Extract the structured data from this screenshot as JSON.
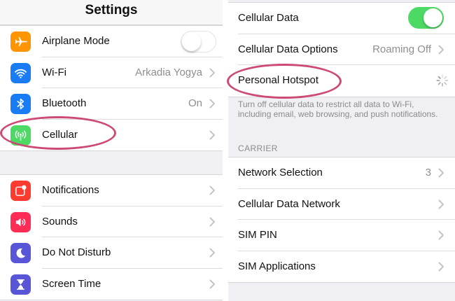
{
  "left": {
    "title": "Settings",
    "group1": [
      {
        "label": "Airplane Mode",
        "icon": "airplane-icon",
        "color": "#ff9500",
        "toggle": "off"
      },
      {
        "label": "Wi-Fi",
        "icon": "wifi-icon",
        "color": "#1a7cf5",
        "value": "Arkadia Yogya"
      },
      {
        "label": "Bluetooth",
        "icon": "bluetooth-icon",
        "color": "#1a7cf5",
        "value": "On"
      },
      {
        "label": "Cellular",
        "icon": "cellular-icon",
        "color": "#4cd964"
      }
    ],
    "group2": [
      {
        "label": "Notifications",
        "icon": "notifications-icon",
        "color": "#ff3b30"
      },
      {
        "label": "Sounds",
        "icon": "speaker-icon",
        "color": "#ff2d55"
      },
      {
        "label": "Do Not Disturb",
        "icon": "moon-icon",
        "color": "#5856d6"
      },
      {
        "label": "Screen Time",
        "icon": "hourglass-icon",
        "color": "#5856d6"
      }
    ]
  },
  "right": {
    "group1": [
      {
        "label": "Cellular Data",
        "toggle": "on"
      },
      {
        "label": "Cellular Data Options",
        "value": "Roaming Off"
      },
      {
        "label": "Personal Hotspot",
        "loading": true
      }
    ],
    "footer": "Turn off cellular data to restrict all data to Wi-Fi, including email, web browsing, and push notifications.",
    "carrier_header": "CARRIER",
    "group2": [
      {
        "label": "Network Selection",
        "value": "3"
      },
      {
        "label": "Cellular Data Network"
      },
      {
        "label": "SIM PIN"
      },
      {
        "label": "SIM Applications"
      }
    ]
  },
  "colors": {
    "highlight": "#cc4a73",
    "toggle_on": "#4cd964",
    "secondary_text": "#8e8e93"
  }
}
